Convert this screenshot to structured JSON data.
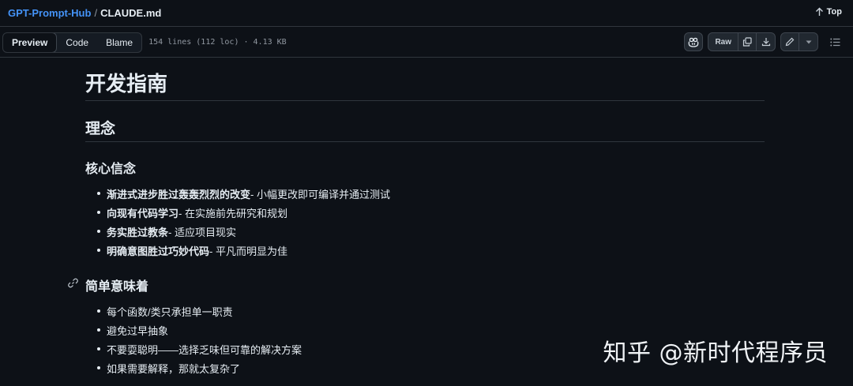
{
  "breadcrumb": {
    "repo": "GPT-Prompt-Hub",
    "separator": "/",
    "file": "CLAUDE.md"
  },
  "top_link": {
    "label": "Top",
    "icon": "arrow-up-icon"
  },
  "view_tabs": [
    {
      "label": "Preview",
      "active": true
    },
    {
      "label": "Code",
      "active": false
    },
    {
      "label": "Blame",
      "active": false
    }
  ],
  "file_info": "154 lines (112 loc) · 4.13 KB",
  "toolbar": {
    "copilot_icon": "copilot-icon",
    "raw_label": "Raw",
    "copy_icon": "copy-icon",
    "download_icon": "download-icon",
    "edit_icon": "pencil-icon",
    "more_icon": "triangle-down-icon",
    "outline_icon": "list-unordered-icon"
  },
  "doc": {
    "title": "开发指南",
    "section": "理念",
    "core": {
      "heading": "核心信念",
      "items": [
        {
          "bold": "渐进式进步胜过轰轰烈烈的改变",
          "text": " - 小幅更改即可编译并通过测试"
        },
        {
          "bold": "向现有代码学习",
          "text": " - 在实施前先研究和规划"
        },
        {
          "bold": "务实胜过教条",
          "text": " - 适应项目现实"
        },
        {
          "bold": "明确意图胜过巧妙代码",
          "text": " - 平凡而明显为佳"
        }
      ]
    },
    "simple": {
      "heading": "简单意味着",
      "items": [
        "每个函数/类只承担单一职责",
        "避免过早抽象",
        "不要耍聪明——选择乏味但可靠的解决方案",
        "如果需要解释，那就太复杂了"
      ]
    }
  },
  "watermark": "知乎 @新时代程序员"
}
